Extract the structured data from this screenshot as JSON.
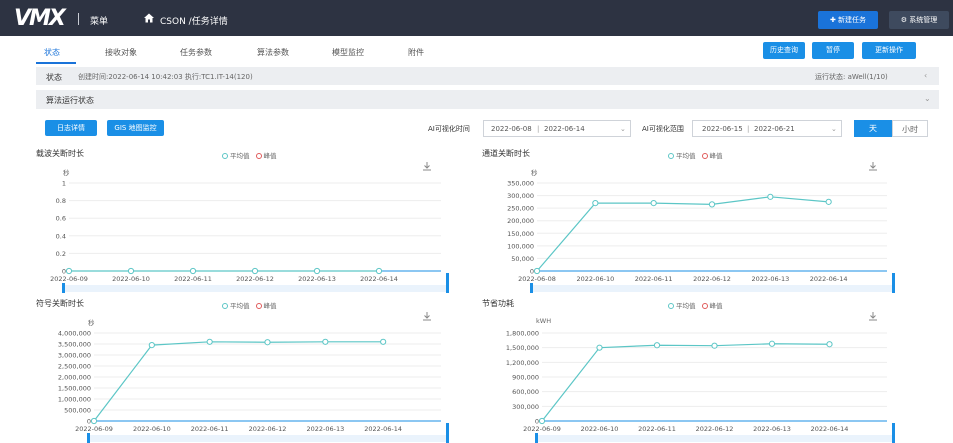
{
  "app": {
    "logo": "VMX",
    "menu_label": "菜单",
    "breadcrumb": "CSON /任务详情"
  },
  "header_buttons": {
    "new_task": "✚ 新建任务",
    "system": "⚙ 系统管理"
  },
  "tabs": [
    "状态",
    "接收对象",
    "任务参数",
    "算法参数",
    "模型监控",
    "附件"
  ],
  "actions": [
    "历史查询",
    "暂停",
    "更新操作"
  ],
  "status": {
    "label": "状态",
    "info": "创建时间:2022-06-14 10:42:03 执行:TC1.IT-14(120)",
    "right": "运行状态: aWell(1/10)"
  },
  "section": {
    "label": "算法运行状态"
  },
  "tools": {
    "btn1": "日志详情",
    "btn2": "GIS 地图监控"
  },
  "range1": {
    "label": "AI可视化时间",
    "start": "2022-06-08",
    "end": "2022-06-14"
  },
  "range2": {
    "label": "AI可视化范围",
    "start": "2022-06-15",
    "end": "2022-06-21"
  },
  "granularity": {
    "day": "天",
    "hour": "小时"
  },
  "legend": {
    "a": "平均值",
    "b": "峰值"
  },
  "colors": {
    "accent": "#1a8fe6",
    "series_a": "#5cc6c6",
    "series_b": "#e05a5a",
    "topbar": "#2d3342"
  },
  "chart_data": [
    {
      "type": "line",
      "title": "载波关断时长",
      "unit": "秒",
      "categories": [
        "2022-06-09",
        "2022-06-10",
        "2022-06-11",
        "2022-06-12",
        "2022-06-13",
        "2022-06-14"
      ],
      "yticks": [
        "1",
        "0.8",
        "0.6",
        "0.4",
        "0.2",
        "0"
      ],
      "ylim": [
        0,
        1
      ],
      "series": [
        {
          "name": "平均值",
          "values": [
            0,
            0,
            0,
            0,
            0,
            0
          ]
        }
      ]
    },
    {
      "type": "line",
      "title": "通道关断时长",
      "unit": "秒",
      "categories": [
        "2022-06-08",
        "2022-06-10",
        "2022-06-11",
        "2022-06-12",
        "2022-06-13",
        "2022-06-14"
      ],
      "yticks": [
        "350,000",
        "300,000",
        "250,000",
        "200,000",
        "150,000",
        "100,000",
        "50,000",
        "0"
      ],
      "ylim": [
        0,
        350000
      ],
      "series": [
        {
          "name": "平均值",
          "values": [
            0,
            270000,
            270000,
            265000,
            295000,
            275000
          ]
        }
      ]
    },
    {
      "type": "line",
      "title": "符号关断时长",
      "unit": "秒",
      "categories": [
        "2022-06-09",
        "2022-06-10",
        "2022-06-11",
        "2022-06-12",
        "2022-06-13",
        "2022-06-14"
      ],
      "yticks": [
        "4,000,000",
        "3,500,000",
        "3,000,000",
        "2,500,000",
        "2,000,000",
        "1,500,000",
        "1,000,000",
        "500,000",
        "0"
      ],
      "ylim": [
        0,
        4000000
      ],
      "series": [
        {
          "name": "平均值",
          "values": [
            0,
            3450000,
            3600000,
            3580000,
            3600000,
            3600000
          ]
        }
      ]
    },
    {
      "type": "line",
      "title": "节省功耗",
      "unit": "kWH",
      "categories": [
        "2022-06-09",
        "2022-06-10",
        "2022-06-11",
        "2022-06-12",
        "2022-06-13",
        "2022-06-14"
      ],
      "yticks": [
        "1,800,000",
        "1,500,000",
        "1,200,000",
        "900,000",
        "600,000",
        "300,000",
        "0"
      ],
      "ylim": [
        0,
        1800000
      ],
      "series": [
        {
          "name": "平均值",
          "values": [
            0,
            1500000,
            1550000,
            1540000,
            1580000,
            1570000
          ]
        }
      ]
    }
  ]
}
